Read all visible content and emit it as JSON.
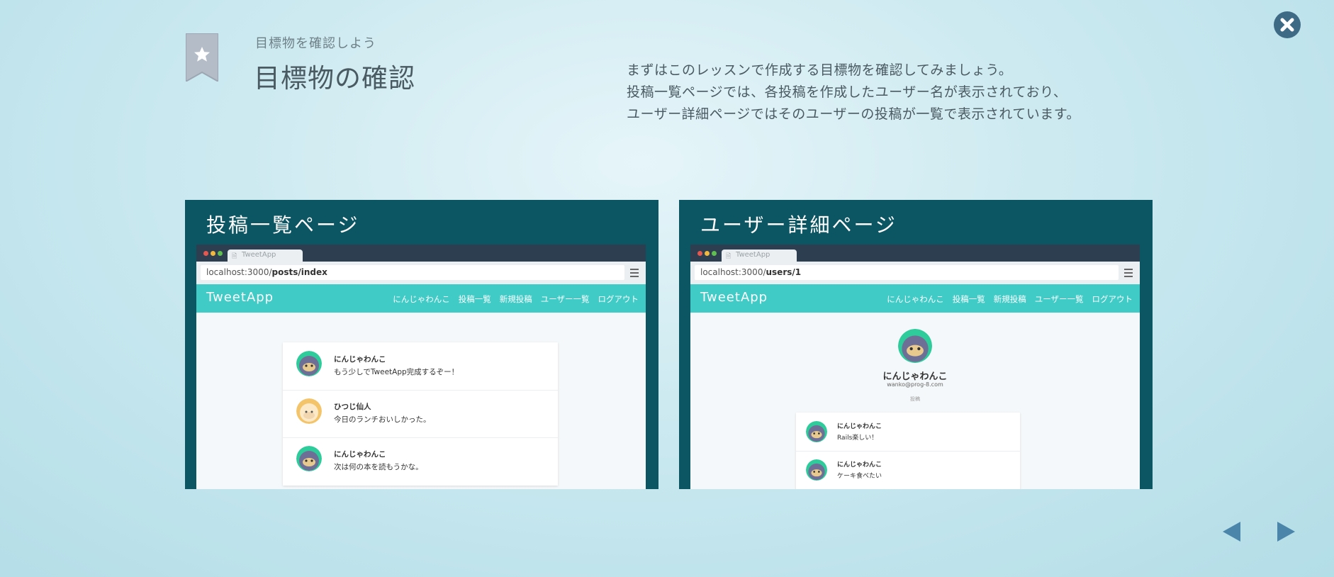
{
  "header": {
    "subtitle": "目標物を確認しよう",
    "title": "目標物の確認",
    "description": [
      "まずはこのレッスンで作成する目標物を確認してみましょう。",
      "投稿一覧ページでは、各投稿を作成したユーザー名が表示されており、",
      "ユーザー詳細ページではそのユーザーの投稿が一覧で表示されています。"
    ]
  },
  "icons": {
    "bookmark": "star-bookmark-icon",
    "close": "close-icon",
    "prev": "prev-arrow-icon",
    "next": "next-arrow-icon"
  },
  "colors": {
    "panel_bg": "#0c5563",
    "app_nav": "#40cbc6",
    "chrome_bar": "#2c3e50",
    "close_btn": "#3e6a86",
    "arrow": "#4b86aa"
  },
  "panels": [
    {
      "title": "投稿一覧ページ",
      "tab_label": "TweetApp",
      "url_prefix": "localhost:3000/",
      "url_path": "posts/index",
      "app_logo": "TweetApp",
      "nav_links": [
        "にんじゃわんこ",
        "投稿一覧",
        "新規投稿",
        "ユーザー一覧",
        "ログアウト"
      ],
      "posts": [
        {
          "name": "にんじゃわんこ",
          "text": "もう少しでTweetApp完成するぞー！",
          "avatar": "ninja-wanko-avatar"
        },
        {
          "name": "ひつじ仙人",
          "text": "今日のランチおいしかった。",
          "avatar": "hitsuji-sennin-avatar"
        },
        {
          "name": "にんじゃわんこ",
          "text": "次は何の本を読もうかな。",
          "avatar": "ninja-wanko-avatar"
        }
      ]
    },
    {
      "title": "ユーザー詳細ページ",
      "tab_label": "TweetApp",
      "url_prefix": "localhost:3000/",
      "url_path": "users/1",
      "app_logo": "TweetApp",
      "nav_links": [
        "にんじゃわんこ",
        "投稿一覧",
        "新規投稿",
        "ユーザー一覧",
        "ログアウト"
      ],
      "profile": {
        "name": "にんじゃわんこ",
        "email": "wanko@prog-8.com",
        "tab": "投稿"
      },
      "posts": [
        {
          "name": "にんじゃわんこ",
          "text": "Rails楽しい！",
          "avatar": "ninja-wanko-avatar"
        },
        {
          "name": "にんじゃわんこ",
          "text": "ケーキ食べたい",
          "avatar": "ninja-wanko-avatar"
        }
      ]
    }
  ]
}
